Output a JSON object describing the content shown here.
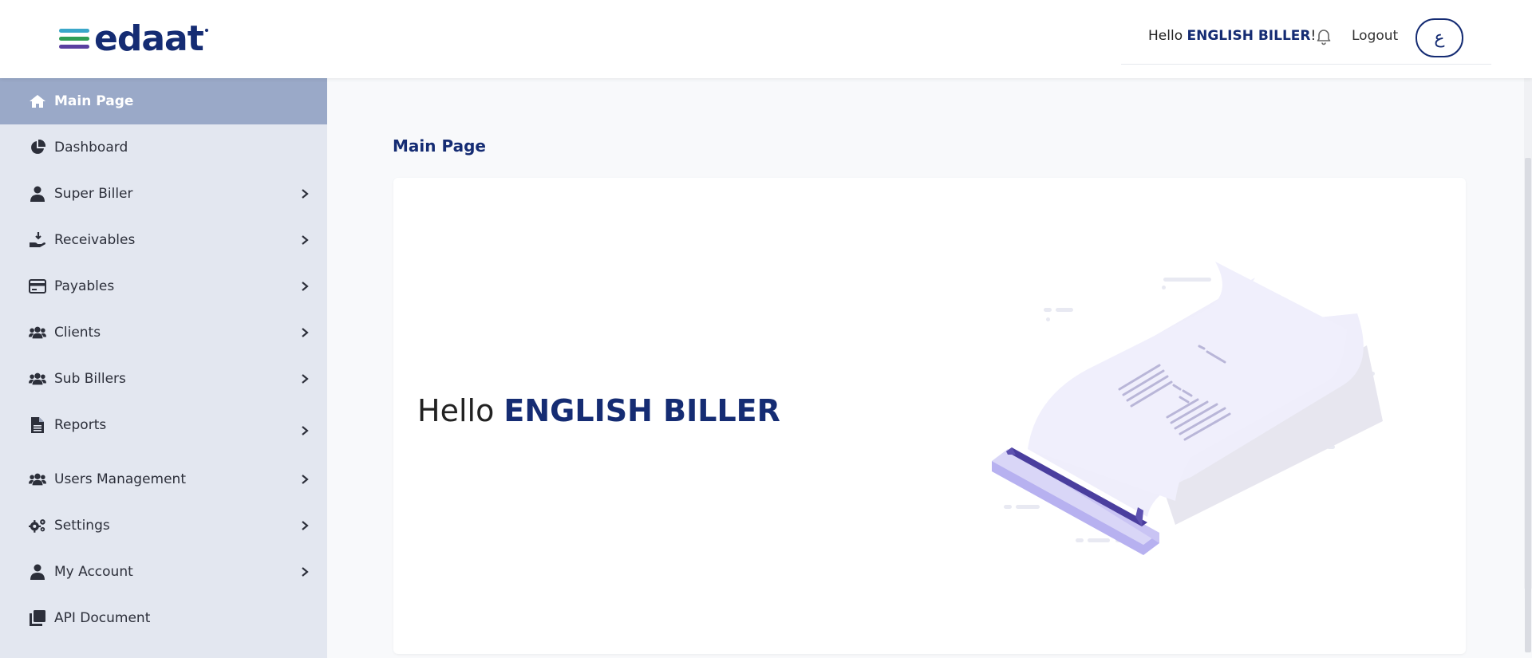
{
  "brand": {
    "name": "edaat"
  },
  "header": {
    "greeting_prefix": "Hello",
    "user_name": "ENGLISH BILLER",
    "greeting_suffix": "!",
    "logout_label": "Logout",
    "language_label": "ع",
    "bell_icon": "bell-icon"
  },
  "sidebar": {
    "items": [
      {
        "label": "Main Page",
        "icon": "home-icon",
        "active": true,
        "has_submenu": false
      },
      {
        "label": "Dashboard",
        "icon": "pie-chart-icon",
        "active": false,
        "has_submenu": false
      },
      {
        "label": "Super Biller",
        "icon": "user-icon",
        "active": false,
        "has_submenu": true
      },
      {
        "label": "Receivables",
        "icon": "hand-coin-icon",
        "active": false,
        "has_submenu": true
      },
      {
        "label": "Payables",
        "icon": "credit-card-icon",
        "active": false,
        "has_submenu": true
      },
      {
        "label": "Clients",
        "icon": "users-icon",
        "active": false,
        "has_submenu": true
      },
      {
        "label": "Sub Billers",
        "icon": "users-icon",
        "active": false,
        "has_submenu": true
      },
      {
        "label": "Reports",
        "icon": "file-icon",
        "active": false,
        "has_submenu": true
      },
      {
        "label": "Users Management",
        "icon": "users-icon",
        "active": false,
        "has_submenu": true
      },
      {
        "label": "Settings",
        "icon": "gears-icon",
        "active": false,
        "has_submenu": true
      },
      {
        "label": "My Account",
        "icon": "user-icon",
        "active": false,
        "has_submenu": true
      },
      {
        "label": "API Document",
        "icon": "copy-icon",
        "active": false,
        "has_submenu": false
      }
    ]
  },
  "main": {
    "title": "Main Page",
    "hello_prefix": "Hello",
    "hello_name": "ENGLISH BILLER"
  },
  "colors": {
    "brand_navy": "#152c73",
    "sidebar_bg": "#e3e7f0",
    "sidebar_active_bg": "#9aa9c8",
    "page_bg": "#f8f9fb"
  }
}
